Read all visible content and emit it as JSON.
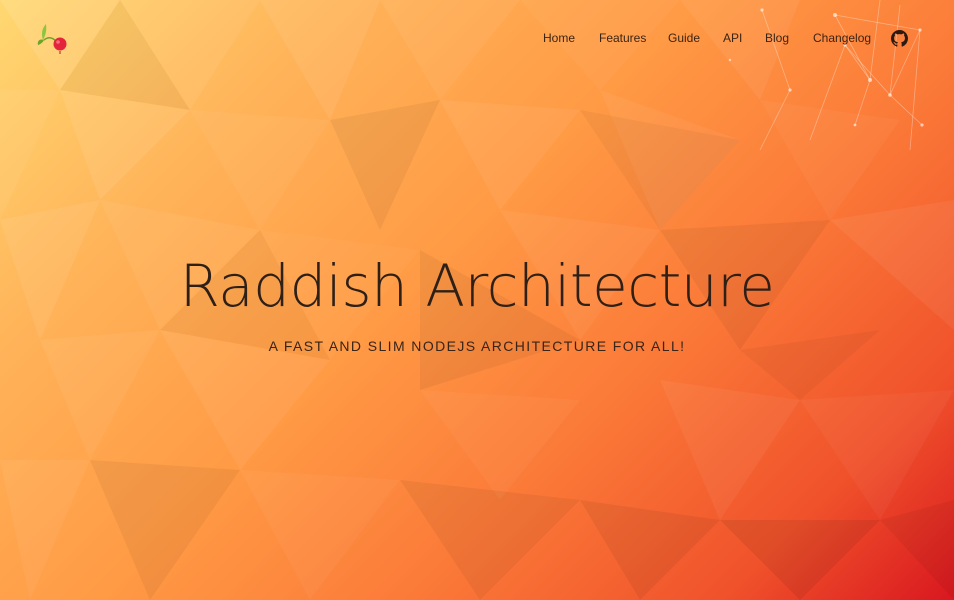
{
  "nav": {
    "logo": "raddish-logo-icon",
    "items": [
      {
        "label": "Home"
      },
      {
        "label": "Features"
      },
      {
        "label": "Guide"
      },
      {
        "label": "API"
      },
      {
        "label": "Blog"
      },
      {
        "label": "Changelog"
      }
    ],
    "github_icon": "github-icon"
  },
  "hero": {
    "title": "Raddish Architecture",
    "subtitle": "A FAST AND SLIM NODEJS ARCHITECTURE FOR ALL!"
  },
  "colors": {
    "gradient_start": "#ffd872",
    "gradient_mid": "#ff9a45",
    "gradient_end": "#d9171f",
    "text": "#2e1f17"
  }
}
